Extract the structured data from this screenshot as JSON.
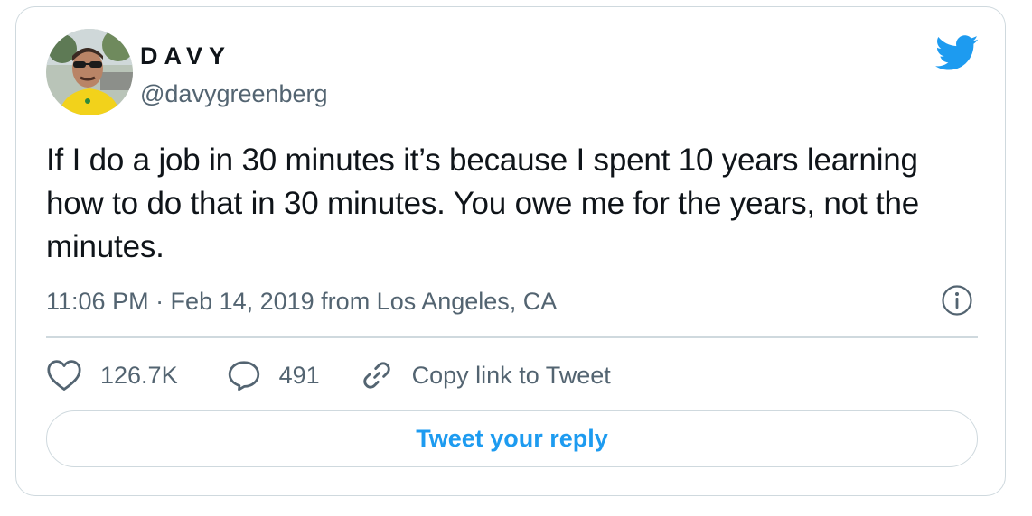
{
  "author": {
    "display_name": "DAVY",
    "handle": "@davygreenberg",
    "avatar": "profile-photo"
  },
  "tweet": {
    "text": "If I do a job in 30 minutes it’s because I spent 10 years learning how to do that in 30 minutes. You owe me for the years, not the minutes.",
    "meta": "11:06 PM · Feb 14, 2019 from Los Angeles, CA"
  },
  "actions": {
    "likes": "126.7K",
    "replies": "491",
    "copy_link": "Copy link to Tweet"
  },
  "reply_button": {
    "label": "Tweet your reply"
  },
  "icons": {
    "brand": "twitter-bird-icon",
    "info": "info-icon",
    "like": "heart-icon",
    "reply": "speech-bubble-icon",
    "link": "link-icon"
  },
  "colors": {
    "accent": "#1d9bf0",
    "text": "#0f1419",
    "muted": "#536471",
    "border": "#cfd9de"
  }
}
